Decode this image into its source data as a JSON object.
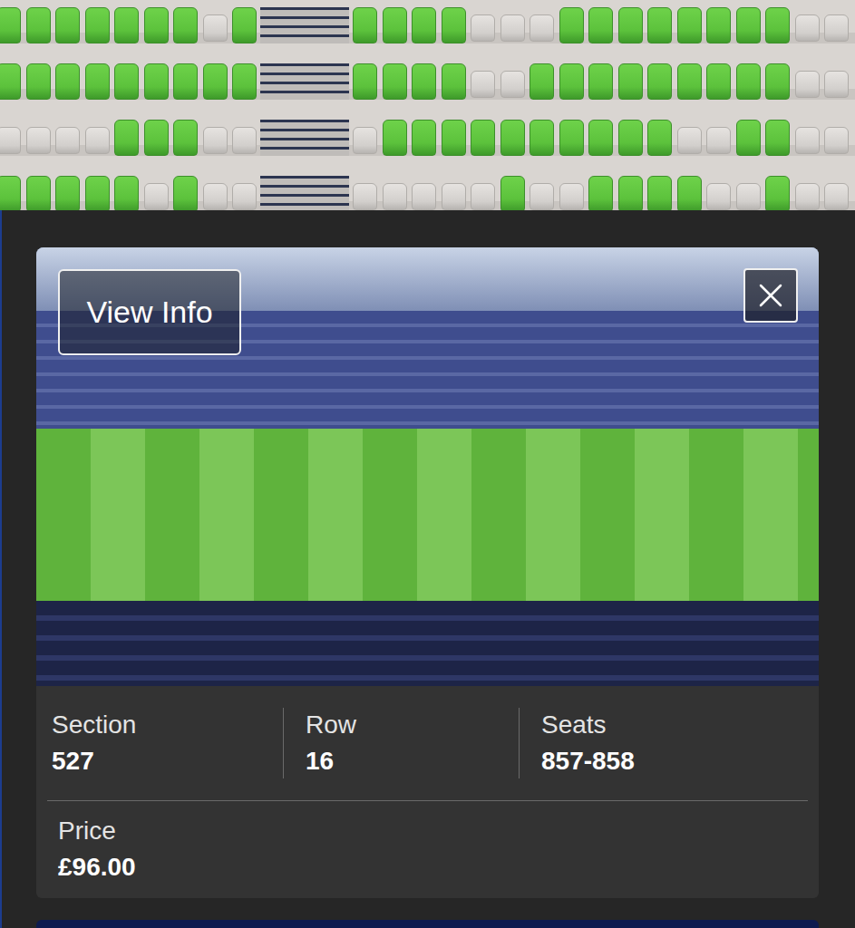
{
  "seat_map": {
    "rows": [
      {
        "left": [
          {
            "available": true
          },
          {
            "available": true
          },
          {
            "available": true
          },
          {
            "available": true
          },
          {
            "available": true
          },
          {
            "available": true
          },
          {
            "available": true
          },
          {
            "available": false
          },
          {
            "available": true
          }
        ],
        "right": [
          {
            "available": true
          },
          {
            "available": true
          },
          {
            "available": true
          },
          {
            "available": true
          },
          {
            "available": false
          },
          {
            "available": false
          },
          {
            "available": false
          },
          {
            "available": true
          },
          {
            "available": true
          },
          {
            "available": true
          },
          {
            "available": true
          },
          {
            "available": true
          },
          {
            "available": true
          },
          {
            "available": true
          },
          {
            "available": true
          },
          {
            "available": false
          },
          {
            "available": false
          }
        ]
      },
      {
        "left": [
          {
            "available": true
          },
          {
            "available": true
          },
          {
            "available": true
          },
          {
            "available": true
          },
          {
            "available": true
          },
          {
            "available": true
          },
          {
            "available": true
          },
          {
            "available": true
          },
          {
            "available": true
          }
        ],
        "right": [
          {
            "available": true
          },
          {
            "available": true
          },
          {
            "available": true
          },
          {
            "available": true
          },
          {
            "available": false
          },
          {
            "available": false
          },
          {
            "available": true
          },
          {
            "available": true
          },
          {
            "available": true
          },
          {
            "available": true
          },
          {
            "available": true
          },
          {
            "available": true
          },
          {
            "available": true
          },
          {
            "available": true
          },
          {
            "available": true
          },
          {
            "available": false
          },
          {
            "available": false
          }
        ]
      },
      {
        "left": [
          {
            "available": false
          },
          {
            "available": false
          },
          {
            "available": false
          },
          {
            "available": false
          },
          {
            "available": true
          },
          {
            "available": true
          },
          {
            "available": true
          },
          {
            "available": false
          },
          {
            "available": false
          }
        ],
        "right": [
          {
            "available": false
          },
          {
            "available": true
          },
          {
            "available": true
          },
          {
            "available": true
          },
          {
            "available": true
          },
          {
            "available": true
          },
          {
            "available": true
          },
          {
            "available": true
          },
          {
            "available": true
          },
          {
            "available": true
          },
          {
            "available": true
          },
          {
            "available": false
          },
          {
            "available": false
          },
          {
            "available": true
          },
          {
            "available": true
          },
          {
            "available": false
          },
          {
            "available": false
          }
        ]
      },
      {
        "left": [
          {
            "available": true
          },
          {
            "available": true
          },
          {
            "available": true
          },
          {
            "available": true
          },
          {
            "available": true
          },
          {
            "available": false
          },
          {
            "available": true
          },
          {
            "available": false
          },
          {
            "available": false
          }
        ],
        "right": [
          {
            "available": false
          },
          {
            "available": false
          },
          {
            "available": false
          },
          {
            "available": false
          },
          {
            "available": false
          },
          {
            "available": true
          },
          {
            "available": false
          },
          {
            "available": false
          },
          {
            "available": true
          },
          {
            "available": true
          },
          {
            "available": true
          },
          {
            "available": true
          },
          {
            "available": false
          },
          {
            "available": false
          },
          {
            "available": true
          },
          {
            "available": false
          },
          {
            "available": false
          }
        ]
      }
    ]
  },
  "view_button": "View Info",
  "details": [
    {
      "label": "Section",
      "value": "527"
    },
    {
      "label": "Row",
      "value": "16"
    },
    {
      "label": "Seats",
      "value": "857-858"
    }
  ],
  "price": {
    "label": "Price",
    "value": "£96.00"
  }
}
